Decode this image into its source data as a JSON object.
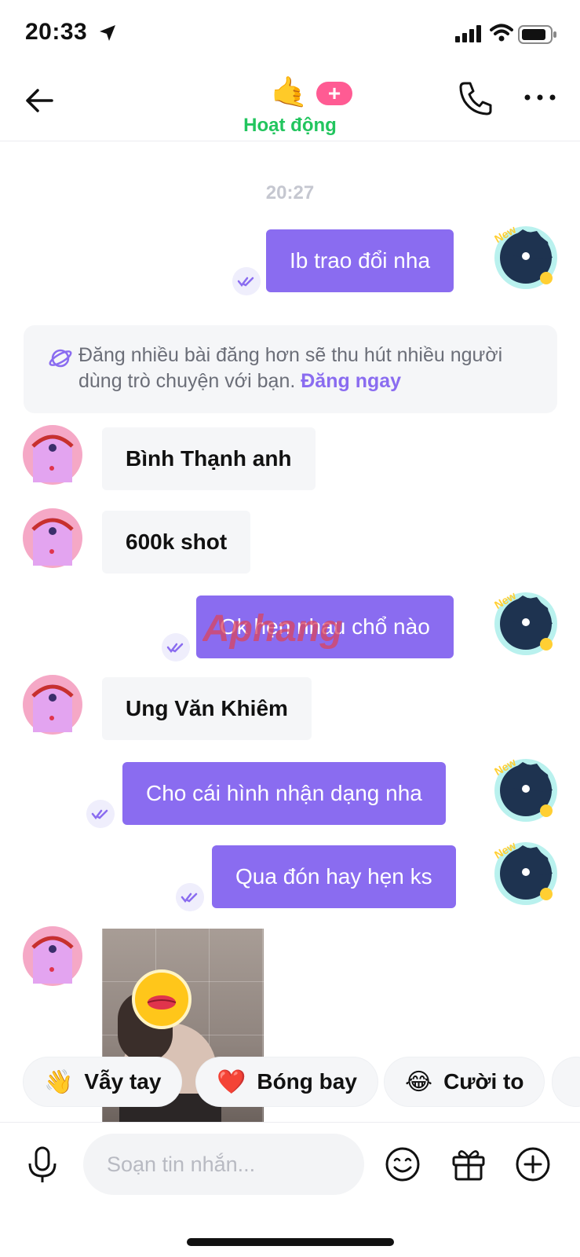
{
  "status_bar": {
    "time": "20:33"
  },
  "header": {
    "avatar_emoji": "🤙",
    "plus": "+",
    "status": "Hoạt động"
  },
  "chat": {
    "time_divider": "20:27",
    "tip": {
      "text": "Đăng nhiều bài đăng hơn sẽ thu hút nhiều người dùng trò chuyện với bạn. ",
      "link": "Đăng ngay"
    },
    "messages": [
      {
        "from": "me",
        "text": "Ib trao đổi nha"
      },
      {
        "from": "her",
        "text": "Bình Thạnh anh"
      },
      {
        "from": "her",
        "text": "600k shot"
      },
      {
        "from": "me",
        "text": "Ok hẹn nhau chổ nào"
      },
      {
        "from": "her",
        "text": "Ung Văn Khiêm"
      },
      {
        "from": "me",
        "text": "Cho cái hình nhận dạng nha"
      },
      {
        "from": "me",
        "text": "Qua đón hay hẹn ks"
      }
    ],
    "avatar_badge": "New"
  },
  "quick_replies": [
    {
      "emoji": "👋",
      "label": "Vẫy tay"
    },
    {
      "emoji": "❤️",
      "label": "Bóng bay"
    },
    {
      "emoji": "😂",
      "label": "Cười to"
    }
  ],
  "composer": {
    "placeholder": "Soạn tin nhắn..."
  },
  "watermark": "Aphang",
  "colors": {
    "accent": "#8a6cf0",
    "online": "#22c55e",
    "badge": "#ff5b93",
    "bubble_in": "#f5f6f8"
  }
}
